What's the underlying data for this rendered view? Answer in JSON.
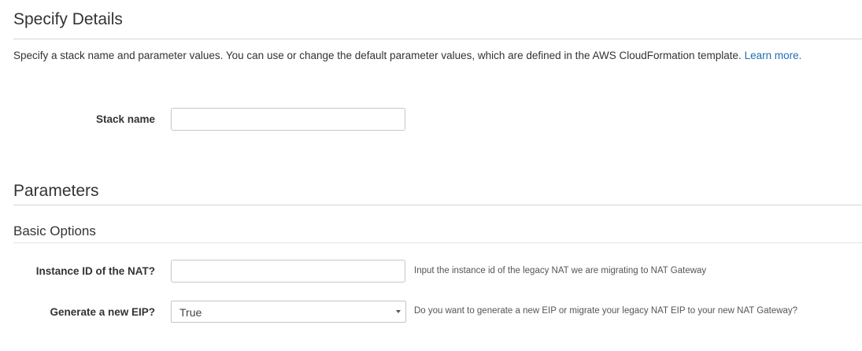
{
  "details": {
    "title": "Specify Details",
    "description": "Specify a stack name and parameter values. You can use or change the default parameter values, which are defined in the AWS CloudFormation template.",
    "learn_more": "Learn more.",
    "stack_name_label": "Stack name",
    "stack_name_value": ""
  },
  "parameters": {
    "title": "Parameters",
    "basic_options_title": "Basic Options",
    "nat_instance": {
      "label": "Instance ID of the NAT?",
      "value": "",
      "hint": "Input the instance id of the legacy NAT we are migrating to NAT Gateway"
    },
    "generate_eip": {
      "label": "Generate a new EIP?",
      "selected": "True",
      "hint": "Do you want to generate a new EIP or migrate your legacy NAT EIP to your new NAT Gateway?",
      "icon": "dropdown-arrow-icon"
    }
  }
}
